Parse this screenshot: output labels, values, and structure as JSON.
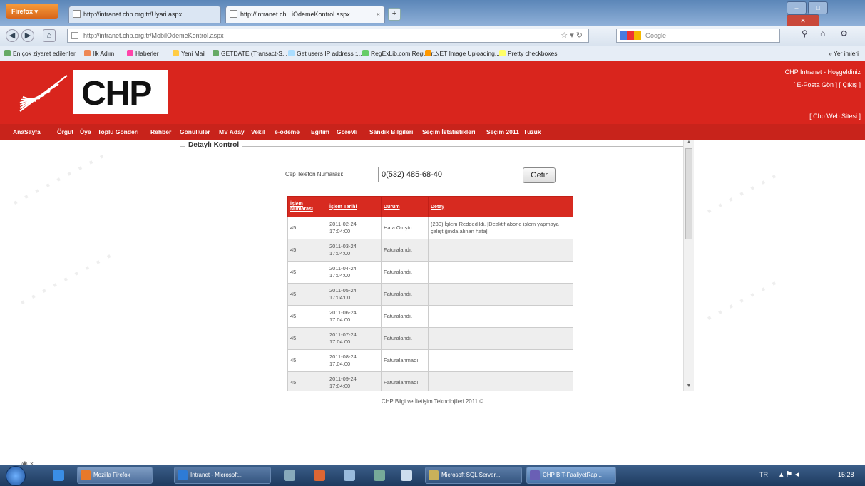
{
  "browser": {
    "menu_button": "Firefox ▾",
    "tabs": [
      {
        "label": "http://intranet.chp.org.tr/Uyari.aspx"
      },
      {
        "label": "http://intranet.ch...iOdemeKontrol.aspx"
      }
    ],
    "new_tab": "+",
    "url": "http://intranet.chp.org.tr/MobilOdemeKontrol.aspx",
    "search_placeholder": "Google",
    "bookmarks": [
      "En çok ziyaret edilenler",
      "İlk Adım",
      "Haberler",
      "Yeni Mail",
      "GETDATE (Transact-S...",
      "Get users IP address :...",
      "RegExLib.com Regular...",
      ".NET Image Uploading...",
      "Pretty checkboxes"
    ],
    "bookmarks_right": "» Yer imleri"
  },
  "header": {
    "logo_text": "CHP",
    "welcome": "CHP Intranet - Hoşgeldiniz",
    "user_links": "[ E-Posta Gön ] [ Çıkış ]",
    "web_link": "[ Chp Web Sitesi ]"
  },
  "menu": [
    "AnaSayfa",
    "Örgüt",
    "Üye",
    "Toplu Gönderi",
    "Rehber",
    "Gönüllüler",
    "MV Aday",
    "Vekil",
    "e-ödeme",
    "Eğitim",
    "Görevli",
    "Sandık Bilgileri",
    "Seçim İstatistikleri",
    "Seçim 2011",
    "Tüzük"
  ],
  "form": {
    "legend": "Detaylı Kontrol",
    "phone_label": "Cep Telefon Numarası:",
    "phone_value": "0(532) 485-68-40",
    "go_button": "Getir"
  },
  "grid": {
    "headers": [
      "İşlem Numarası",
      "İşlem Tarihi",
      "Durum",
      "Detay"
    ],
    "rows": [
      [
        "45",
        "2011-02-24 17:04:00",
        "Hata Oluştu.",
        "(230) İşlem Reddedildi. [Deaktif abone işlem yapmaya çalıştığında alınan hata]"
      ],
      [
        "45",
        "2011-03-24 17:04:00",
        "Faturalandı.",
        ""
      ],
      [
        "45",
        "2011-04-24 17:04:00",
        "Faturalandı.",
        ""
      ],
      [
        "45",
        "2011-05-24 17:04:00",
        "Faturalandı.",
        ""
      ],
      [
        "45",
        "2011-06-24 17:04:00",
        "Faturalandı.",
        ""
      ],
      [
        "45",
        "2011-07-24 17:04:00",
        "Faturalandı.",
        ""
      ],
      [
        "45",
        "2011-08-24 17:04:00",
        "Faturalanmadı.",
        ""
      ],
      [
        "45",
        "2011-09-24 17:04:00",
        "Faturalanmadı.",
        ""
      ]
    ]
  },
  "footer": {
    "text": "CHP Bilgi ve İletişim Teknolojileri 2011 ©"
  },
  "taskbar": {
    "tasks": [
      "Mozilla Firefox",
      "Intranet - Microsoft...",
      "Microsoft SQL Server...",
      "CHP BIT-FaaliyetRap..."
    ],
    "lang": "TR",
    "time": "15:28"
  },
  "colors": {
    "brand_red": "#d9251d",
    "menu_red": "#c8231b",
    "grid_header": "#d72a20"
  }
}
